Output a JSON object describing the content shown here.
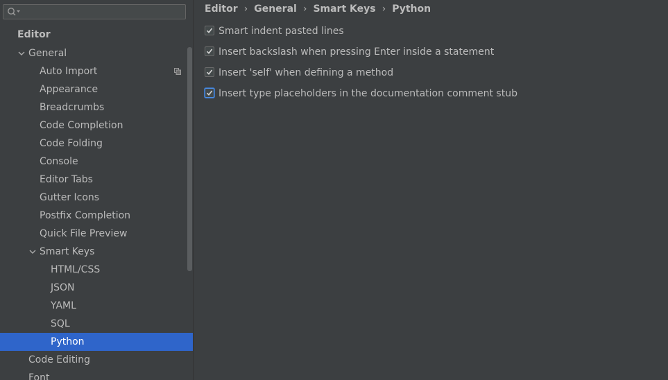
{
  "search": {
    "value": ""
  },
  "tree": {
    "section_title": "Editor",
    "items": [
      {
        "label": "General",
        "expanded": true
      },
      {
        "label": "Auto Import"
      },
      {
        "label": "Appearance"
      },
      {
        "label": "Breadcrumbs"
      },
      {
        "label": "Code Completion"
      },
      {
        "label": "Code Folding"
      },
      {
        "label": "Console"
      },
      {
        "label": "Editor Tabs"
      },
      {
        "label": "Gutter Icons"
      },
      {
        "label": "Postfix Completion"
      },
      {
        "label": "Quick File Preview"
      },
      {
        "label": "Smart Keys",
        "expanded": true
      },
      {
        "label": "HTML/CSS"
      },
      {
        "label": "JSON"
      },
      {
        "label": "YAML"
      },
      {
        "label": "SQL"
      },
      {
        "label": "Python",
        "selected": true
      },
      {
        "label": "Code Editing"
      },
      {
        "label": "Font"
      }
    ]
  },
  "breadcrumb": [
    "Editor",
    "General",
    "Smart Keys",
    "Python"
  ],
  "options": [
    {
      "label": "Smart indent pasted lines",
      "checked": true
    },
    {
      "label": "Insert backslash when pressing Enter inside a statement",
      "checked": true
    },
    {
      "label": "Insert 'self' when defining a method",
      "checked": true
    },
    {
      "label": "Insert type placeholders in the documentation comment stub",
      "checked": true,
      "focused": true
    }
  ],
  "icons": {
    "search": "search-icon",
    "expand": "chevron-down-icon",
    "project_scope": "project-scope-icon",
    "check": "checkmark-icon"
  },
  "colors": {
    "background": "#3c3f41",
    "selection": "#2f65ca",
    "text": "#bbbbbb",
    "focus": "#4b8ee8"
  }
}
